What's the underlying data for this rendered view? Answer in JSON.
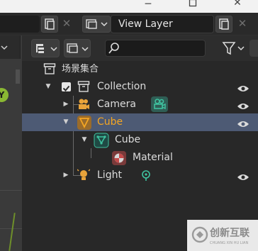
{
  "header": {
    "view_layer_label": "View Layer"
  },
  "outliner": {
    "scene_name": "场景集合",
    "rows": [
      {
        "label": "Collection"
      },
      {
        "label": "Camera"
      },
      {
        "label": "Cube"
      },
      {
        "label": "Cube"
      },
      {
        "label": "Material"
      },
      {
        "label": "Light"
      }
    ]
  },
  "viewport": {
    "gizmo_axis": "Y"
  },
  "watermark": {
    "brand": "创新互联",
    "sub": "CHUANG XIN HU LIAN"
  },
  "colors": {
    "selected_row": "#4d5a74",
    "selected_text": "#f5a623",
    "camera_icon": "#e8a33a",
    "object_data_icon": "#3fc3a0",
    "light_icon": "#e8a33a"
  }
}
